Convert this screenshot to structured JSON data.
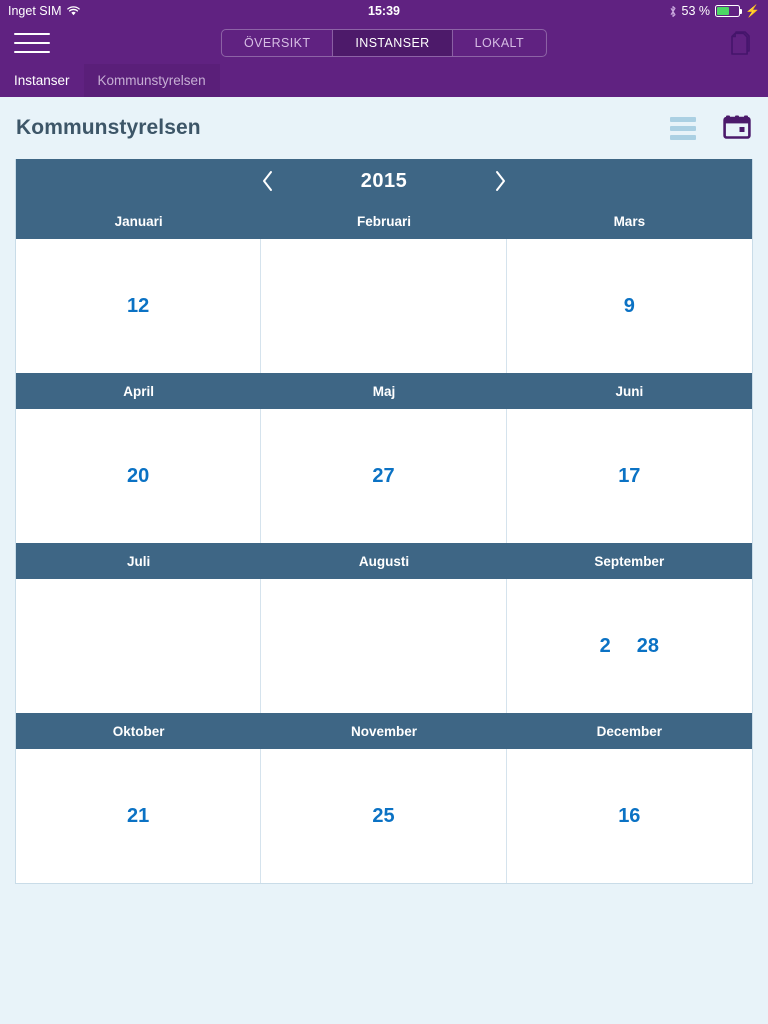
{
  "statusbar": {
    "carrier": "Inget SIM",
    "wifi_icon": "wifi-icon",
    "time": "15:39",
    "bluetooth_icon": "bluetooth-icon",
    "battery_percent": "53 %",
    "battery_level": 53,
    "charging_icon": "lightning-bolt-icon"
  },
  "navbar": {
    "menu_icon": "hamburger-menu-icon",
    "segments": [
      {
        "label": "ÖVERSIKT",
        "active": false
      },
      {
        "label": "INSTANSER",
        "active": true
      },
      {
        "label": "LOKALT",
        "active": false
      }
    ],
    "documents_icon": "documents-copy-icon"
  },
  "breadcrumbs": [
    {
      "label": "Instanser",
      "active": true
    },
    {
      "label": "Kommunstyrelsen",
      "active": false
    }
  ],
  "page": {
    "title": "Kommunstyrelsen",
    "list_view_icon": "list-view-icon",
    "calendar_view_icon": "calendar-view-icon"
  },
  "calendar": {
    "year": "2015",
    "prev_icon": "chevron-left-icon",
    "next_icon": "chevron-right-icon",
    "rows": [
      {
        "months": [
          {
            "name": "Januari",
            "dates": [
              "12"
            ]
          },
          {
            "name": "Februari",
            "dates": []
          },
          {
            "name": "Mars",
            "dates": [
              "9"
            ]
          }
        ]
      },
      {
        "months": [
          {
            "name": "April",
            "dates": [
              "20"
            ]
          },
          {
            "name": "Maj",
            "dates": [
              "27"
            ]
          },
          {
            "name": "Juni",
            "dates": [
              "17"
            ]
          }
        ]
      },
      {
        "months": [
          {
            "name": "Juli",
            "dates": []
          },
          {
            "name": "Augusti",
            "dates": []
          },
          {
            "name": "September",
            "dates": [
              "2",
              "28"
            ]
          }
        ]
      },
      {
        "months": [
          {
            "name": "Oktober",
            "dates": [
              "21"
            ]
          },
          {
            "name": "November",
            "dates": [
              "25"
            ]
          },
          {
            "name": "December",
            "dates": [
              "16"
            ]
          }
        ]
      }
    ]
  },
  "colors": {
    "brand_purple": "#602281",
    "brand_purple_dark": "#4d1a6a",
    "calendar_header": "#3e6685",
    "date_blue": "#0b72c4",
    "page_background": "#e8f3f9",
    "title_text": "#3d5668"
  }
}
